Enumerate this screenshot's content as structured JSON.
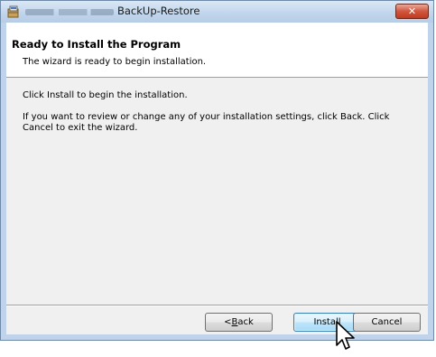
{
  "window": {
    "title": "BackUp-Restore",
    "close_label": "✕"
  },
  "header": {
    "title": "Ready to Install the Program",
    "subtitle": "The wizard is ready to begin installation."
  },
  "body": {
    "line1": "Click Install to begin the installation.",
    "line2": "If you want to review or change any of your installation settings, click Back. Click Cancel to exit the wizard."
  },
  "buttons": {
    "back_prefix": "< ",
    "back_mnemonic": "B",
    "back_rest": "ack",
    "install": "Install",
    "cancel": "Cancel"
  },
  "icons": {
    "app": "installer-package-icon",
    "close": "close-icon",
    "cursor": "mouse-pointer-icon"
  }
}
